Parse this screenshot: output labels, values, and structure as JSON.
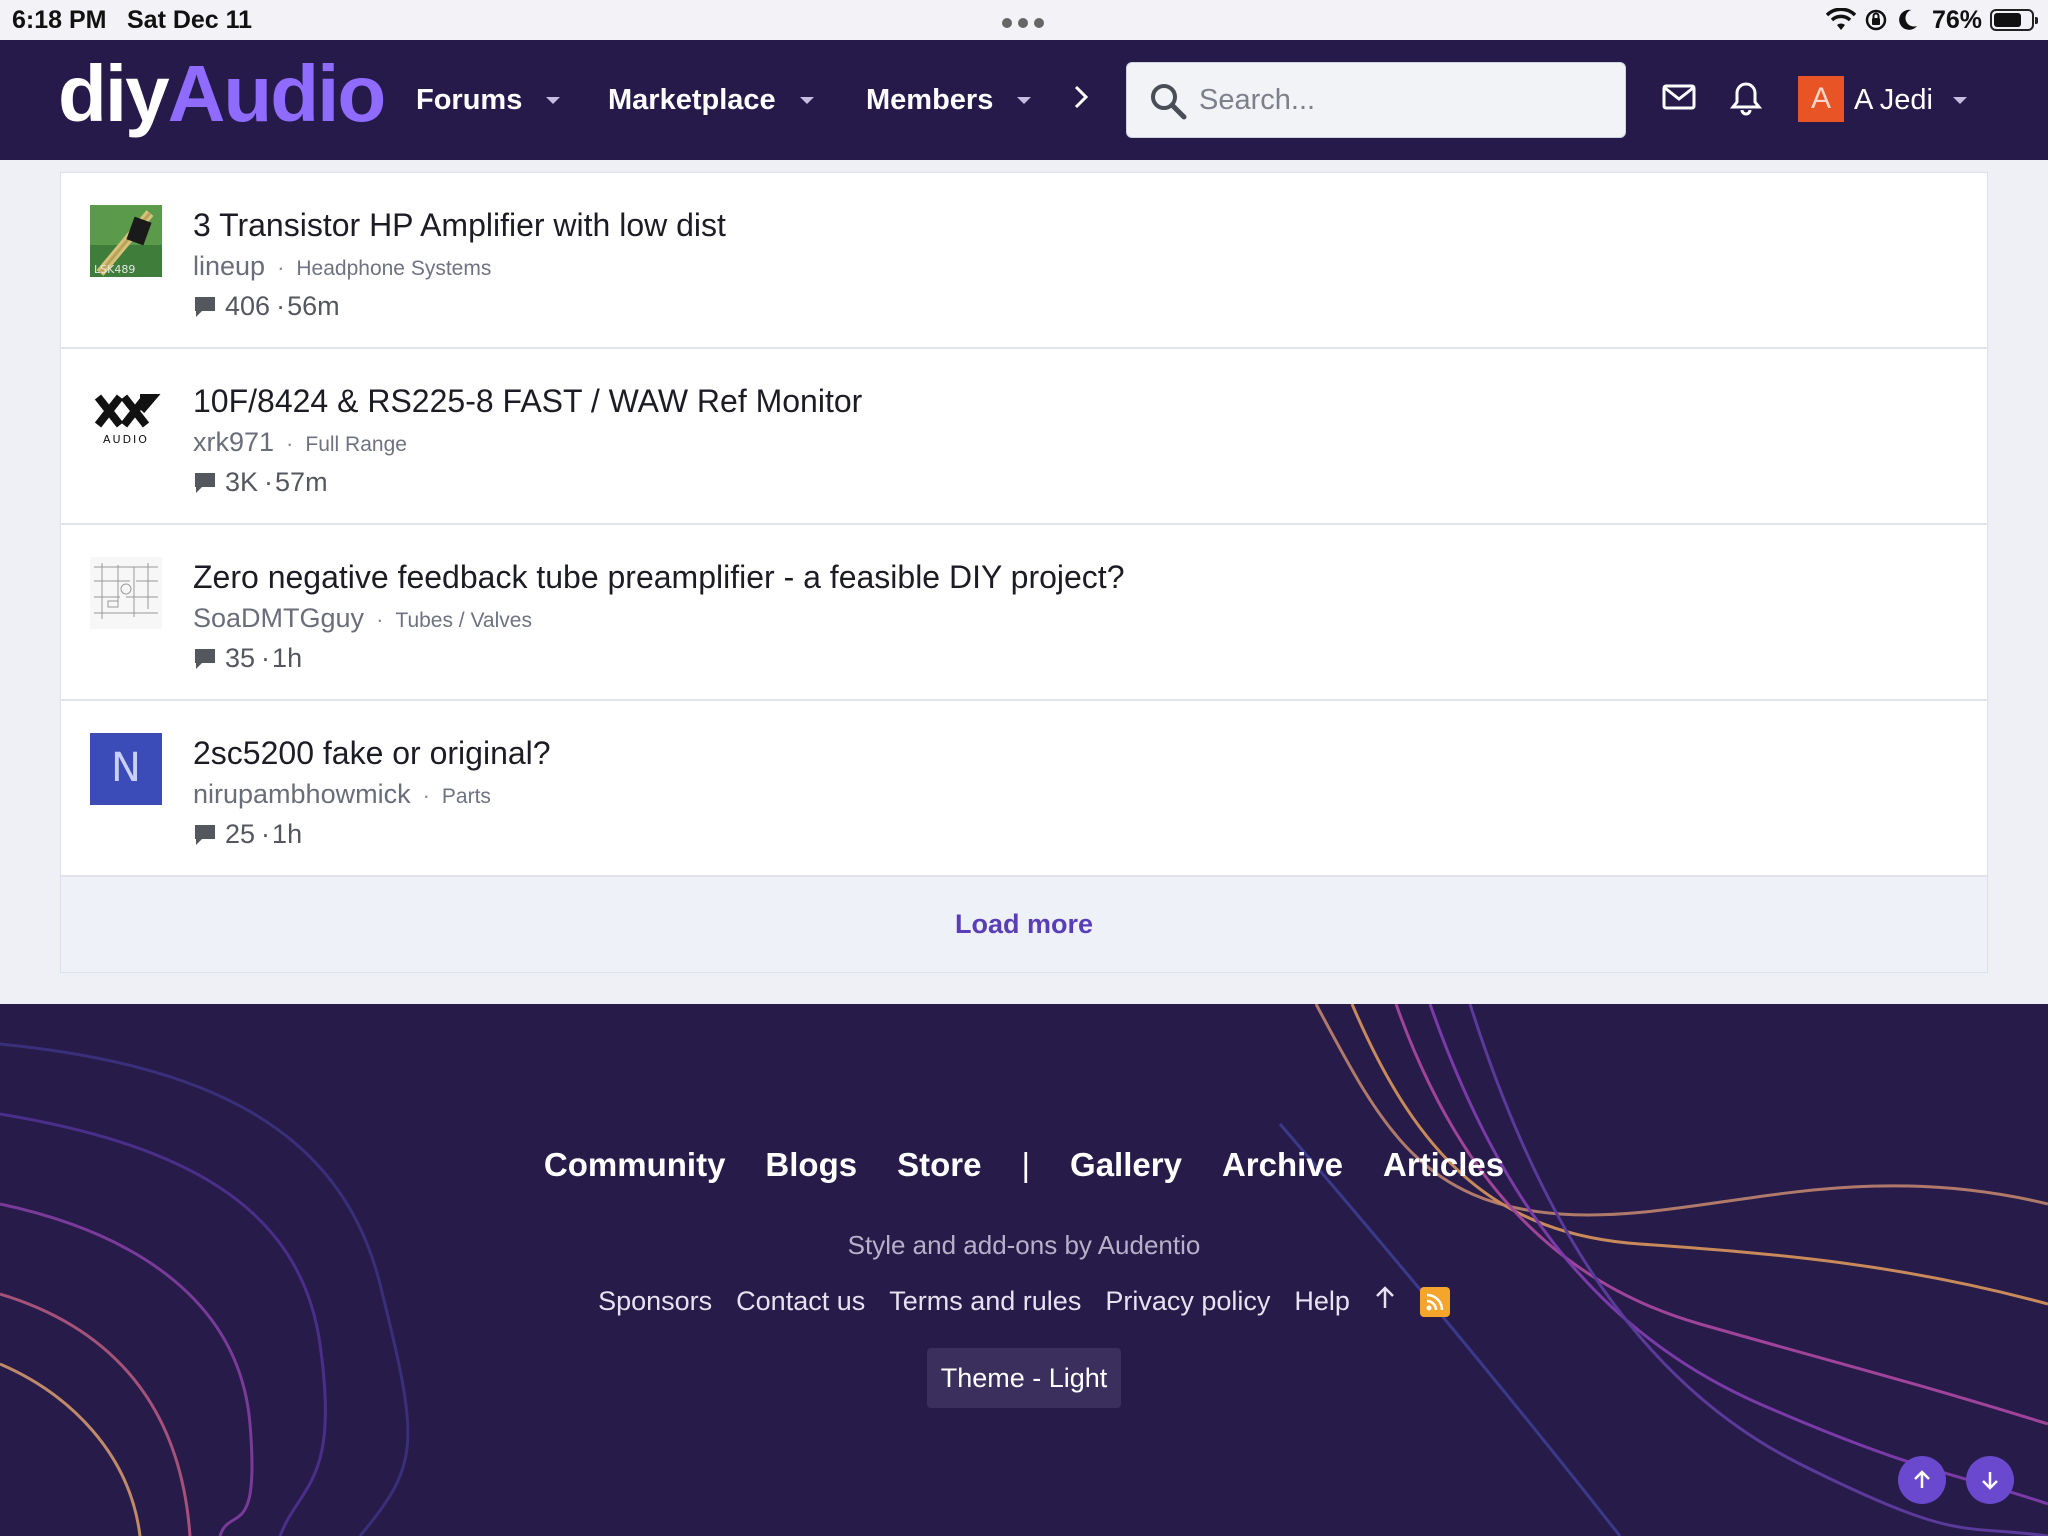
{
  "status_bar": {
    "time": "6:18 PM",
    "date": "Sat Dec 11",
    "battery": "76%",
    "battery_level": 0.76
  },
  "nav": {
    "logo_part1": "diy",
    "logo_part2": "Audio",
    "items": [
      {
        "label": "Forums"
      },
      {
        "label": "Marketplace"
      },
      {
        "label": "Members"
      }
    ],
    "more_icon": "chevron-right-icon",
    "search_placeholder": "Search...",
    "avatar_letter": "A",
    "username": "A Jedi"
  },
  "threads": [
    {
      "title": "3 Transistor HP Amplifier with low dist",
      "author": "lineup",
      "forum": "Headphone Systems",
      "replies": "406",
      "time": "56m",
      "thumb_text": "LSK489"
    },
    {
      "title": "10F/8424 & RS225-8 FAST / WAW Ref Monitor",
      "author": "xrk971",
      "forum": "Full Range",
      "replies": "3K",
      "time": "57m",
      "thumb_text": "AUDIO"
    },
    {
      "title": "Zero negative feedback tube preamplifier - a feasible DIY project?",
      "author": "SoaDMTGguy",
      "forum": "Tubes / Valves",
      "replies": "35",
      "time": "1h"
    },
    {
      "title": "2sc5200 fake or original?",
      "author": "nirupambhowmick",
      "forum": "Parts",
      "replies": "25",
      "time": "1h",
      "thumb_text": "N"
    }
  ],
  "separator": "·",
  "load_more": "Load more",
  "footer": {
    "nav": [
      "Community",
      "Blogs",
      "Store",
      "|",
      "Gallery",
      "Archive",
      "Articles"
    ],
    "credit": "Style and add-ons by Audentio",
    "links": [
      "Sponsors",
      "Contact us",
      "Terms and rules",
      "Privacy policy",
      "Help"
    ],
    "theme_button": "Theme - Light"
  },
  "colors": {
    "navbar": "#261a4a",
    "accent": "#8f6cff",
    "link": "#5a3eb8",
    "footer": "#271b49"
  }
}
